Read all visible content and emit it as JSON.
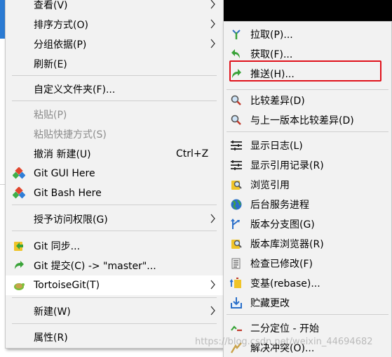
{
  "main_menu": {
    "items": [
      {
        "label": "查看(V)"
      },
      {
        "label": "排序方式(O)"
      },
      {
        "label": "分组依据(P)"
      },
      {
        "label": "刷新(E)"
      },
      {
        "label": "自定义文件夹(F)..."
      },
      {
        "label": "粘贴(P)"
      },
      {
        "label": "粘贴快捷方式(S)"
      },
      {
        "label": "撤消 新建(U)",
        "shortcut": "Ctrl+Z"
      },
      {
        "label": "Git GUI Here"
      },
      {
        "label": "Git Bash Here"
      },
      {
        "label": "授予访问权限(G)"
      },
      {
        "label": "Git 同步..."
      },
      {
        "label": "Git 提交(C) -> \"master\"..."
      },
      {
        "label": "TortoiseGit(T)"
      },
      {
        "label": "新建(W)"
      },
      {
        "label": "属性(R)"
      }
    ]
  },
  "sub_menu": {
    "items": [
      {
        "label": "拉取(P)..."
      },
      {
        "label": "获取(F)..."
      },
      {
        "label": "推送(H)..."
      },
      {
        "label": "比较差异(D)"
      },
      {
        "label": "与上一版本比较差异(D)"
      },
      {
        "label": "显示日志(L)"
      },
      {
        "label": "显示引用记录(R)"
      },
      {
        "label": "浏览引用"
      },
      {
        "label": "后台服务进程"
      },
      {
        "label": "版本分支图(G)"
      },
      {
        "label": "版本库浏览器(R)"
      },
      {
        "label": "检查已修改(F)"
      },
      {
        "label": "变基(rebase)..."
      },
      {
        "label": "贮藏更改"
      },
      {
        "label": "二分定位 - 开始"
      },
      {
        "label": "解决冲突(O)..."
      }
    ]
  },
  "watermark": "https://blog.csdn.net/weixin_44694682",
  "colors": {
    "highlight_box": "#e0121b",
    "menu_bg": "#f2f2f2"
  }
}
